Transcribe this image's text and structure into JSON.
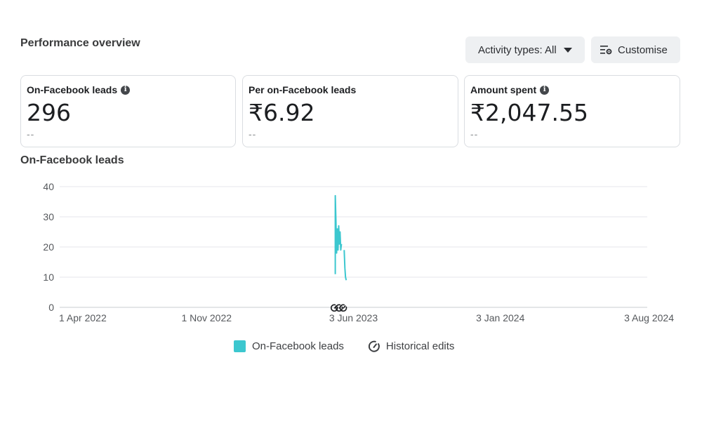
{
  "header": {
    "title": "Performance overview",
    "activity_button": "Activity types: All",
    "customise_button": "Customise"
  },
  "cards": [
    {
      "label": "On-Facebook leads",
      "value": "296",
      "compare": "--",
      "has_info": true
    },
    {
      "label": "Per on-Facebook leads",
      "value": "₹6.92",
      "compare": "--",
      "has_info": false
    },
    {
      "label": "Amount spent",
      "value": "₹2,047.55",
      "compare": "--",
      "has_info": true
    }
  ],
  "chart": {
    "title": "On-Facebook leads"
  },
  "chart_data": {
    "type": "line",
    "title": "On-Facebook leads",
    "xlabel": "",
    "ylabel": "",
    "x_ticks": [
      "1 Apr 2022",
      "1 Nov 2022",
      "3 Jun 2023",
      "3 Jan 2024",
      "3 Aug 2024"
    ],
    "y_ticks": [
      0,
      10,
      20,
      30,
      40
    ],
    "ylim": [
      0,
      40
    ],
    "xlim": [
      "2022-04-01",
      "2024-08-03"
    ],
    "grid": true,
    "series": [
      {
        "name": "On-Facebook leads",
        "color": "#3cc7cf",
        "segments": [
          [
            {
              "x": "2023-05-07",
              "y": 11
            },
            {
              "x": "2023-05-07",
              "y": 37
            },
            {
              "x": "2023-05-08",
              "y": 29
            },
            {
              "x": "2023-05-09",
              "y": 18
            },
            {
              "x": "2023-05-10",
              "y": 26
            },
            {
              "x": "2023-05-11",
              "y": 19
            },
            {
              "x": "2023-05-12",
              "y": 27
            },
            {
              "x": "2023-05-13",
              "y": 21
            },
            {
              "x": "2023-05-14",
              "y": 25
            },
            {
              "x": "2023-05-15",
              "y": 19
            },
            {
              "x": "2023-05-16",
              "y": 21
            }
          ],
          [
            {
              "x": "2023-05-20",
              "y": 19
            },
            {
              "x": "2023-05-21",
              "y": 13
            },
            {
              "x": "2023-05-22",
              "y": 10
            },
            {
              "x": "2023-05-23",
              "y": 9
            }
          ]
        ]
      }
    ],
    "historical_edits": [
      "2023-05-06",
      "2023-05-13",
      "2023-05-19"
    ],
    "legend": {
      "position": "bottom",
      "items": [
        "On-Facebook leads",
        "Historical edits"
      ]
    }
  }
}
